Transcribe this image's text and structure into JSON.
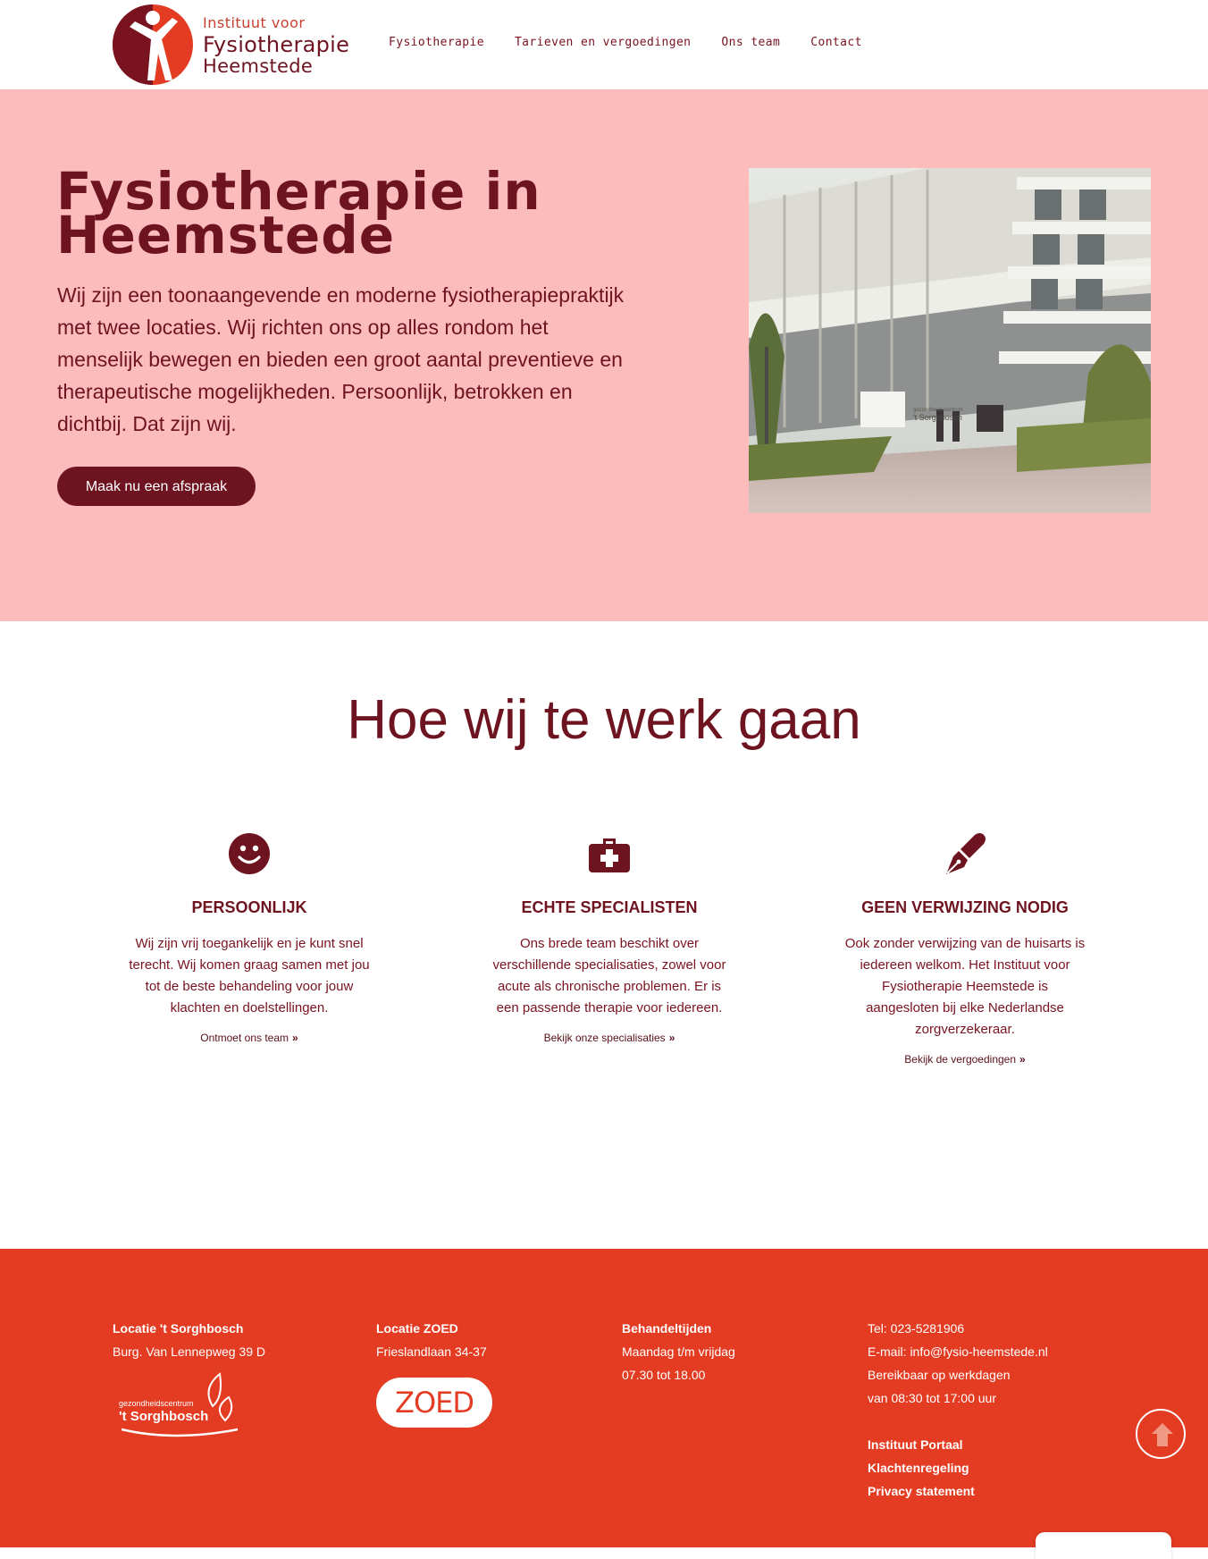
{
  "header": {
    "logo": {
      "line1": "Instituut voor",
      "line2": "Fysiotherapie",
      "line3": "Heemstede"
    },
    "nav": [
      {
        "label": "Fysiotherapie"
      },
      {
        "label": "Tarieven en vergoedingen"
      },
      {
        "label": "Ons team"
      },
      {
        "label": "Contact"
      }
    ]
  },
  "hero": {
    "title": "Fysiotherapie in Heemstede",
    "text": "Wij zijn een toonaangevende en moderne fysiotherapiepraktijk met twee locaties. Wij richten ons op alles rondom het menselijk bewegen en bieden een groot aantal preventieve en therapeutische mogelijkheden. Persoonlijk, betrokken en dichtbij. Dat zijn wij.",
    "button": "Maak nu een afspraak",
    "image_signs": {
      "building_name_small": "gezondheidscentrum",
      "building_name": "'t Sorghbosch"
    }
  },
  "section": {
    "title": "Hoe wij te werk gaan",
    "features": [
      {
        "icon": "smiley-icon",
        "title": "PERSOONLIJK",
        "text": "Wij zijn vrij toegankelijk en je kunt snel terecht. Wij komen graag samen met jou tot de beste behandeling voor jouw klachten en doelstellingen.",
        "link": "Ontmoet ons team"
      },
      {
        "icon": "medical-kit-icon",
        "title": "ECHTE SPECIALISTEN",
        "text": "Ons brede team beschikt over verschillende specialisaties, zowel voor acute als chronische problemen. Er is een passende therapie voor iedereen.",
        "link": "Bekijk onze specialisaties"
      },
      {
        "icon": "fountain-pen-icon",
        "title": "GEEN VERWIJZING NODIG",
        "text": "Ook zonder verwijzing van de huisarts is iedereen welkom. Het Instituut voor Fysiotherapie Heemstede is aangesloten bij elke Nederlandse zorgverzekeraar.",
        "link": "Bekijk de vergoedingen"
      }
    ]
  },
  "footer": {
    "col1": {
      "heading": "Locatie 't Sorghbosch",
      "address": "Burg. Van Lennepweg 39 D",
      "logo_small": "gezondheidscentrum",
      "logo_big": "'t Sorghbosch"
    },
    "col2": {
      "heading": "Locatie ZOED",
      "address": "Frieslandlaan 34-37",
      "logo": "ZOED"
    },
    "col3": {
      "heading": "Behandeltijden",
      "line1": "Maandag t/m vrijdag",
      "line2": "07.30 tot 18.00"
    },
    "col4": {
      "phone": "Tel: 023-5281906",
      "email": "E-mail: info@fysio-heemstede.nl",
      "hours1": "Bereikbaar op werkdagen",
      "hours2": "van 08:30 tot 17:00 uur",
      "links": [
        "Instituut Portaal",
        "Klachtenregeling",
        "Privacy statement"
      ]
    }
  },
  "colors": {
    "brand_dark": "#6e1420",
    "hero_bg": "#fcbcbc",
    "footer_bg": "#e33c22",
    "logo_red": "#c8402f"
  }
}
